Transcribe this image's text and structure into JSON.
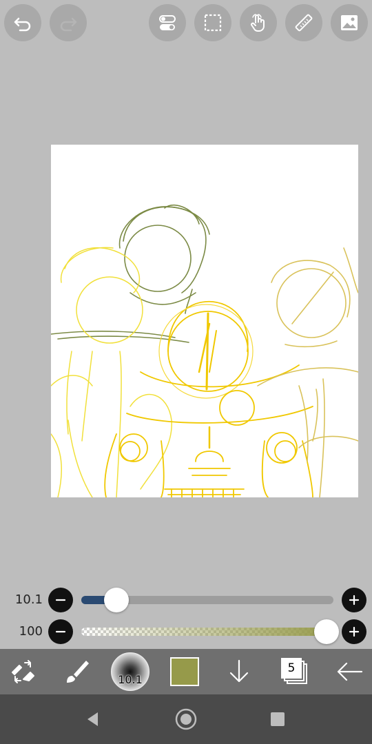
{
  "toolbar": {
    "buttons": [
      {
        "name": "undo-button",
        "icon": "undo-icon"
      },
      {
        "name": "redo-button",
        "icon": "redo-icon"
      },
      {
        "name": "settings-toggle-button",
        "icon": "toggle-icon"
      },
      {
        "name": "selection-button",
        "icon": "dashed-square-icon"
      },
      {
        "name": "hand-tool-button",
        "icon": "hand-icon"
      },
      {
        "name": "ruler-button",
        "icon": "ruler-icon"
      },
      {
        "name": "image-button",
        "icon": "image-icon"
      }
    ]
  },
  "brush_size": {
    "label": "10.1",
    "level": 0.14
  },
  "opacity": {
    "label": "100",
    "level": 1.0
  },
  "bottom_bar": {
    "brush_preview_label": "10.1",
    "current_color": "#969a4a",
    "layer_count": "5"
  },
  "colors": {
    "background": "#bdbdbd",
    "bottom_bar": "#6f6f6f",
    "nav_bar": "#4a4a4a",
    "size_track_fill": "#2a4a72",
    "sketch_yellow": "#f1d600",
    "sketch_olive": "#7b8a45",
    "sketch_mustard": "#d9c25a"
  }
}
